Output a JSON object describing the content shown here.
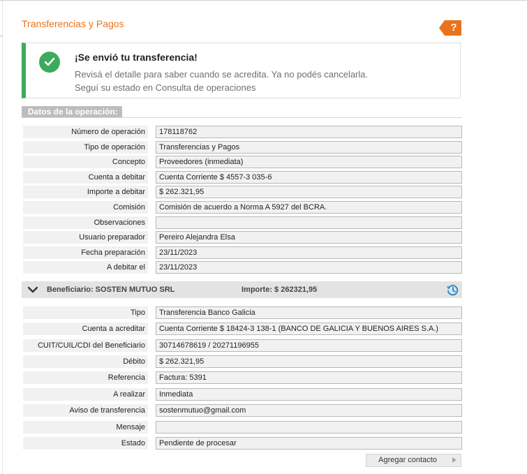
{
  "page": {
    "title": "Transferencias y Pagos",
    "help_label": "?"
  },
  "alert": {
    "title": "¡Se envió tu transferencia!",
    "line1": "Revisá el detalle para saber cuando se acredita. Ya no podés cancelarla.",
    "line2": "Seguí su estado en Consulta de operaciones"
  },
  "operation": {
    "section_label": "Datos de la operación:",
    "fields": [
      {
        "label": "Número de operación",
        "value": "178118762"
      },
      {
        "label": "Tipo de operación",
        "value": "Transferencias y Pagos"
      },
      {
        "label": "Concepto",
        "value": "Proveedores (inmediata)"
      },
      {
        "label": "Cuenta a debitar",
        "value": "Cuenta Corriente $ 4557-3 035-6"
      },
      {
        "label": "Importe a debitar",
        "value": "$ 262.321,95"
      },
      {
        "label": "Comisión",
        "value": "Comisión de acuerdo a Norma A 5927 del BCRA."
      },
      {
        "label": "Observaciones",
        "value": ""
      },
      {
        "label": "Usuario preparador",
        "value": "Pereiro Alejandra Elsa"
      },
      {
        "label": "Fecha preparación",
        "value": "23/11/2023"
      },
      {
        "label": "A debitar el",
        "value": "23/11/2023"
      }
    ]
  },
  "beneficiary": {
    "header": "Beneficiario: SOSTEN MUTUO SRL",
    "amount": "Importe: $ 262321,95",
    "fields": [
      {
        "label": "Tipo",
        "value": "Transferencia Banco Galicia"
      },
      {
        "label": "Cuenta a acreditar",
        "value": "Cuenta Corriente $ 18424-3 138-1 (BANCO DE GALICIA Y BUENOS AIRES S.A.)"
      },
      {
        "label": "CUIT/CUIL/CDI del Beneficiario",
        "value": "30714678619 / 20271196955"
      },
      {
        "label": "Débito",
        "value": "$ 262.321,95"
      },
      {
        "label": "Referencia",
        "value": "Factura: 5391"
      },
      {
        "label": "A realizar",
        "value": "Inmediata"
      },
      {
        "label": "Aviso de transferencia",
        "value": "sostenmutuo@gmail.com"
      },
      {
        "label": "Mensaje",
        "value": ""
      },
      {
        "label": "Estado",
        "value": "Pendiente de procesar"
      }
    ]
  },
  "actions": {
    "add_contact": "Agregar contacto"
  },
  "colors": {
    "accent": "#e8731c",
    "success": "#3daa5c",
    "link": "#2f8fd0"
  }
}
